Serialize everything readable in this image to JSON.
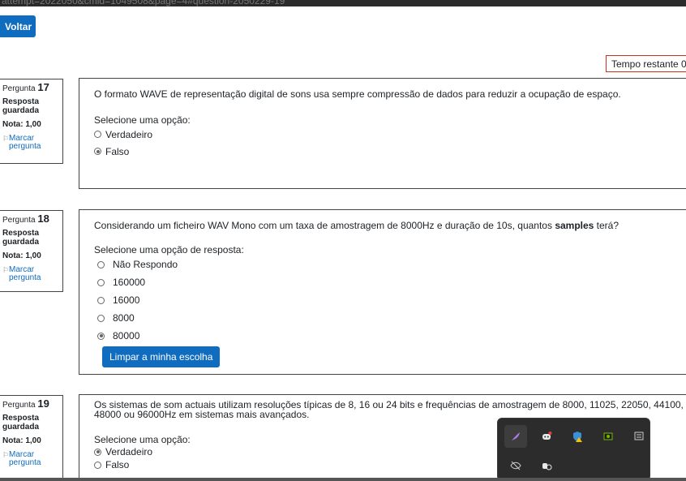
{
  "browser": {
    "url_fragment": "attempt=2022050&cmid=1049508&page=4#question-2050229-19"
  },
  "toolbar": {
    "back_label": "Voltar"
  },
  "timer": {
    "label": "Tempo restante 0"
  },
  "questions": [
    {
      "number_prefix": "Pergunta",
      "number": "17",
      "state": "Resposta guardada",
      "grade": "Nota: 1,00",
      "flag_label": "Marcar pergunta",
      "text": "O formato WAVE de representação digital de sons usa sempre compressão de dados para reduzir a ocupação de espaço.",
      "prompt": "Selecione uma opção:",
      "options": [
        {
          "label": "Verdadeiro",
          "checked": false
        },
        {
          "label": "Falso",
          "checked": true
        }
      ]
    },
    {
      "number_prefix": "Pergunta",
      "number": "18",
      "state": "Resposta guardada",
      "grade": "Nota: 1,00",
      "flag_label": "Marcar pergunta",
      "text_before": "Considerando um ficheiro WAV Mono com um taxa de amostragem de 8000Hz e duração de 10s, quantos ",
      "text_bold": "samples",
      "text_after": " terá?",
      "prompt": "Selecione uma opção de resposta:",
      "options": [
        {
          "label": "Não Respondo",
          "checked": false
        },
        {
          "label": "160000",
          "checked": false
        },
        {
          "label": "16000",
          "checked": false
        },
        {
          "label": "8000",
          "checked": false
        },
        {
          "label": "80000",
          "checked": true
        }
      ],
      "clear_label": "Limpar a minha escolha"
    },
    {
      "number_prefix": "Pergunta",
      "number": "19",
      "state": "Resposta guardada",
      "grade": "Nota: 1,00",
      "flag_label": "Marcar pergunta",
      "text": "Os sistemas de som actuais utilizam resoluções típicas de 8, 16 ou 24 bits e frequências de amostragem de 8000, 11025, 22050, 44100, 48000 ou 96000Hz em sistemas mais avançados.",
      "prompt": "Selecione uma opção:",
      "options": [
        {
          "label": "Verdadeiro",
          "checked": true
        },
        {
          "label": "Falso",
          "checked": false
        }
      ]
    }
  ],
  "tray_icons": [
    "feather-icon",
    "discord-icon",
    "defender-warning-icon",
    "nvidia-icon",
    "display-icon",
    "eye-off-icon",
    "hand-info-icon"
  ],
  "colors": {
    "primary": "#0f6cbf",
    "timer_border": "#ca3120"
  }
}
